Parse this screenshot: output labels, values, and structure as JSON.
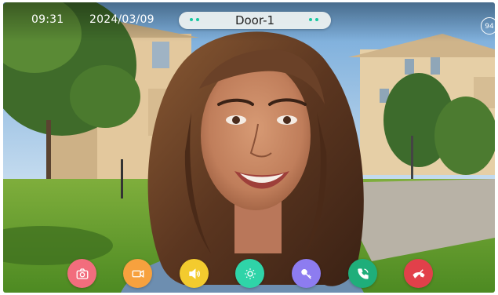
{
  "status_bar": {
    "time": "09:31",
    "date": "2024/03/09",
    "door_name": "Door-1",
    "badge": "94"
  },
  "colors": {
    "indicator": "#17c8a0",
    "snapshot": "#f26d7d",
    "record": "#f7a13e",
    "volume": "#f3cb2e",
    "brightness": "#2fd4a8",
    "unlock": "#8d7cf0",
    "answer": "#1fae7a",
    "hangup": "#e2404a"
  },
  "controls": [
    {
      "name": "snapshot-button",
      "icon": "camera-icon"
    },
    {
      "name": "record-button",
      "icon": "video-camera-icon"
    },
    {
      "name": "volume-button",
      "icon": "speaker-icon"
    },
    {
      "name": "brightness-button",
      "icon": "brightness-icon"
    },
    {
      "name": "unlock-button",
      "icon": "key-icon"
    },
    {
      "name": "answer-button",
      "icon": "phone-icon"
    },
    {
      "name": "hangup-button",
      "icon": "phone-hangup-icon"
    }
  ]
}
